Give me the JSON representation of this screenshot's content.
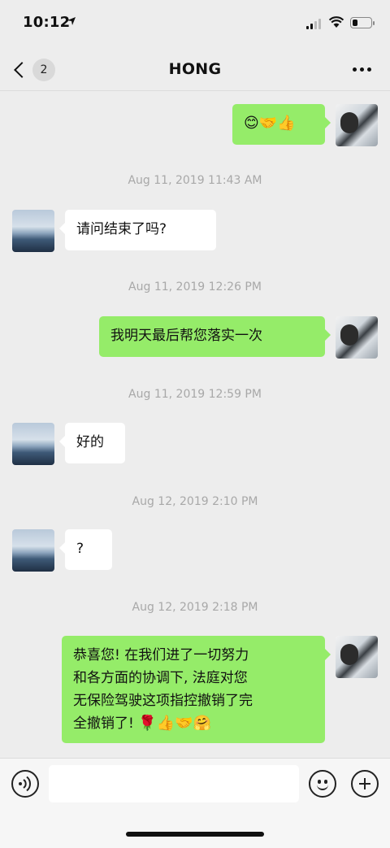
{
  "status_bar": {
    "time": "10:12",
    "battery_level": 0.25
  },
  "nav": {
    "unread_count": "2",
    "title": "HONG"
  },
  "messages": [
    {
      "type": "message",
      "side": "out",
      "text": "",
      "emojis": [
        "😊",
        "🤝",
        "👍"
      ]
    },
    {
      "type": "timestamp",
      "text": "Aug 11, 2019 11:43 AM"
    },
    {
      "type": "message",
      "side": "in",
      "text": "请问结束了吗?"
    },
    {
      "type": "timestamp",
      "text": "Aug 11, 2019 12:26 PM"
    },
    {
      "type": "message",
      "side": "out",
      "text": "我明天最后帮您落实一次"
    },
    {
      "type": "timestamp",
      "text": "Aug 11, 2019 12:59 PM"
    },
    {
      "type": "message",
      "side": "in",
      "text": "好的"
    },
    {
      "type": "timestamp",
      "text": "Aug 12, 2019 2:10 PM"
    },
    {
      "type": "message",
      "side": "in",
      "text": "?"
    },
    {
      "type": "timestamp",
      "text": "Aug 12, 2019 2:18 PM"
    },
    {
      "type": "message",
      "side": "out",
      "lines": [
        "恭喜您! 在我们进了一切努力",
        "和各方面的协调下, 法庭对您",
        "无保险驾驶这项指控撤销了完",
        "全撤销了! "
      ],
      "emojis": [
        "🌹",
        "👍",
        "🤝",
        "🤗"
      ]
    }
  ],
  "colors": {
    "background": "#ededed",
    "incoming_bubble": "#ffffff",
    "outgoing_bubble": "#95ec69",
    "timestamp_text": "#a8a8a8"
  }
}
